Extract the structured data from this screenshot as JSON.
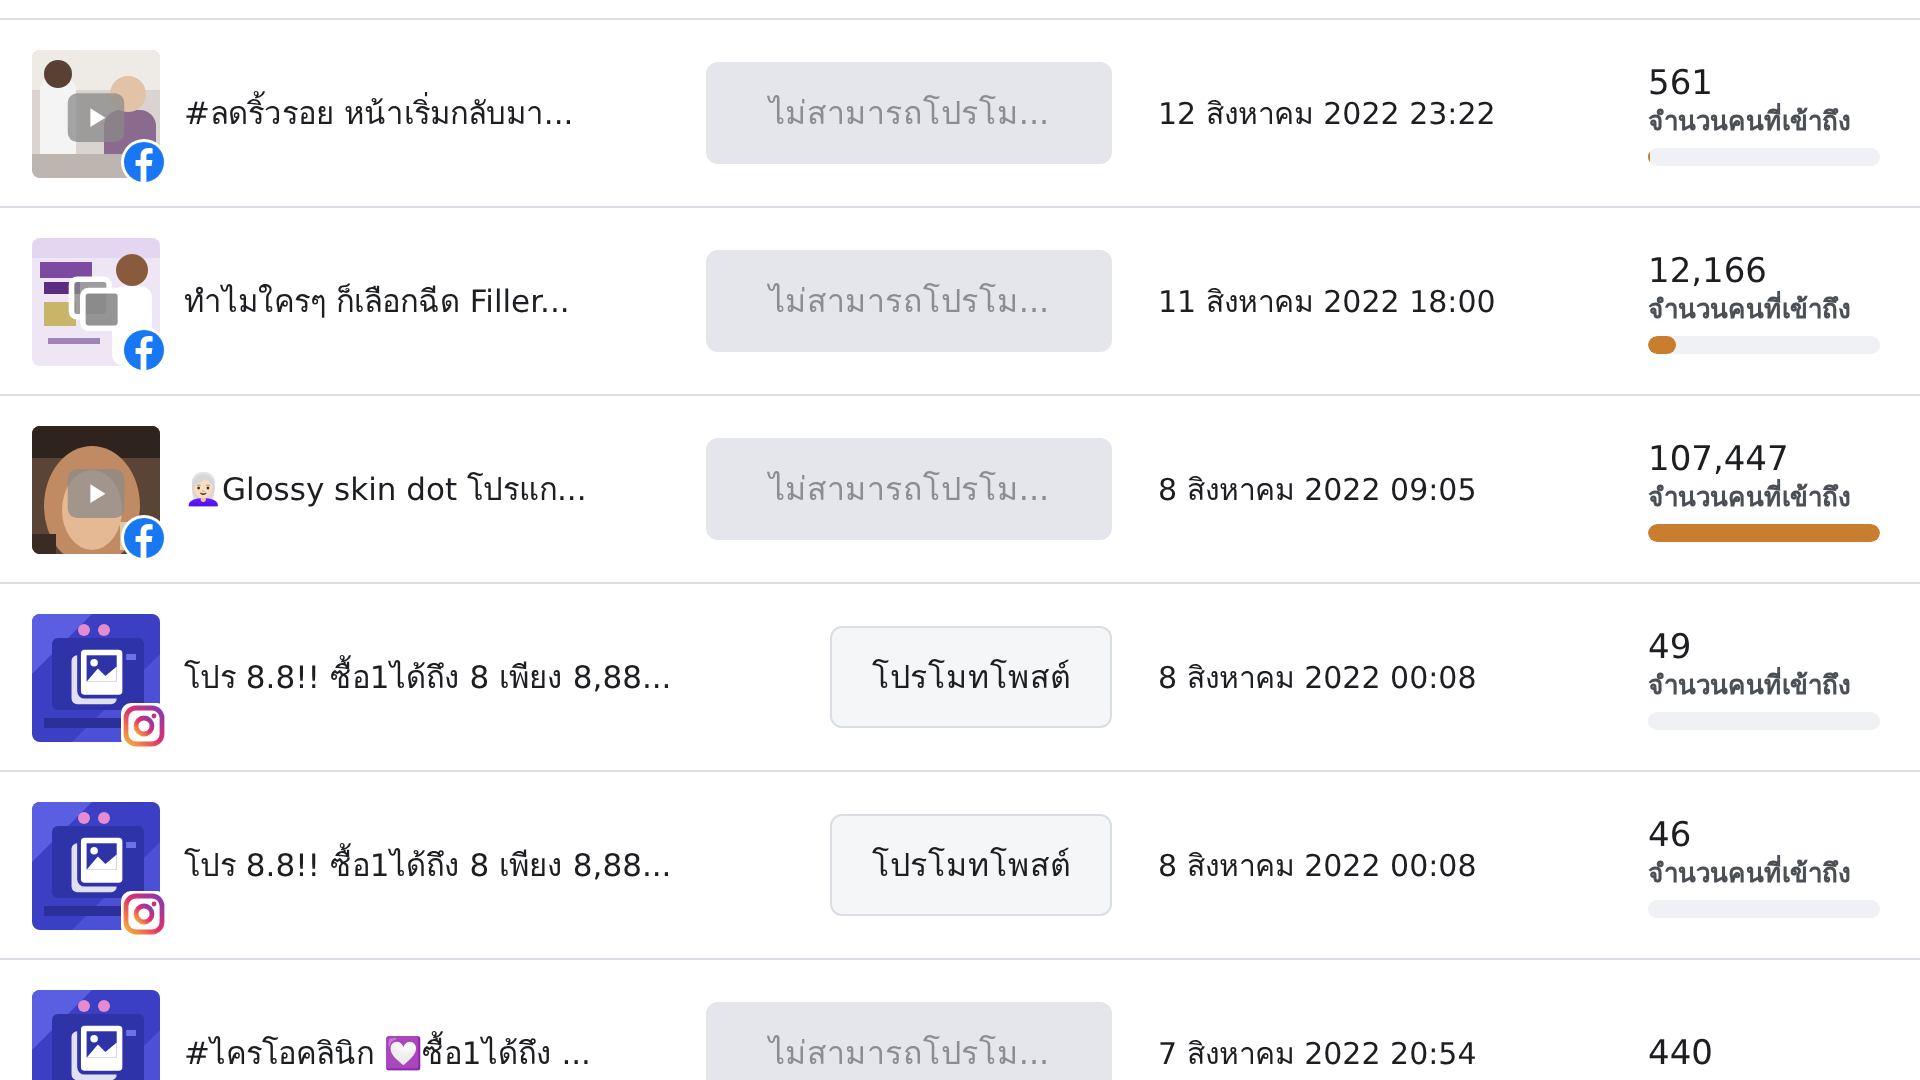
{
  "posts": [
    {
      "thumbnail": {
        "kind": "video"
      },
      "badge": {
        "kind": "facebook"
      },
      "title": "#ลดริ้วรอย หน้าเริ่มกลับมา...",
      "button": {
        "label": "ไม่สามารถโปรโม...",
        "disabled": true
      },
      "date": "12 สิงหาคม 2022 23:22",
      "reach": "561",
      "reach_label": "จำนวนคนที่เข้าถึง",
      "level": 0.006
    },
    {
      "thumbnail": {
        "kind": "carousel"
      },
      "badge": {
        "kind": "facebook"
      },
      "title": "ทำไมใครๆ ก็เลือกฉีด Filler...",
      "button": {
        "label": "ไม่สามารถโปรโม...",
        "disabled": true
      },
      "date": "11 สิงหาคม 2022 18:00",
      "reach": "12,166",
      "reach_label": "จำนวนคนที่เข้าถึง",
      "level": 0.12
    },
    {
      "thumbnail": {
        "kind": "video"
      },
      "badge": {
        "kind": "facebook"
      },
      "title": "👩🏻‍🦳Glossy skin dot โปรแก...",
      "button": {
        "label": "ไม่สามารถโปรโม...",
        "disabled": true
      },
      "date": "8 สิงหาคม 2022 09:05",
      "reach": "107,447",
      "reach_label": "จำนวนคนที่เข้าถึง",
      "level": 1
    },
    {
      "thumbnail": {
        "kind": "gallery"
      },
      "badge": {
        "kind": "instagram"
      },
      "title": "โปร 8.8!! ซื้อ1ได้ถึง 8 เพียง 8,88...",
      "button": {
        "label": "โปรโมทโพสต์",
        "disabled": false
      },
      "date": "8 สิงหาคม 2022 00:08",
      "reach": "49",
      "reach_label": "จำนวนคนที่เข้าถึง",
      "level": 0
    },
    {
      "thumbnail": {
        "kind": "gallery"
      },
      "badge": {
        "kind": "instagram"
      },
      "title": "โปร 8.8!! ซื้อ1ได้ถึง 8 เพียง 8,88...",
      "button": {
        "label": "โปรโมทโพสต์",
        "disabled": false
      },
      "date": "8 สิงหาคม 2022 00:08",
      "reach": "46",
      "reach_label": "จำนวนคนที่เข้าถึง",
      "level": 0
    },
    {
      "thumbnail": {
        "kind": "gallery"
      },
      "title": "#ไครโอคลินิก 💟ซื้อ1ได้ถึง ...",
      "button": {
        "label": "ไม่สามารถโปรโม...",
        "disabled": true
      },
      "date": "7 สิงหาคม 2022 20:54",
      "reach": "440"
    }
  ]
}
